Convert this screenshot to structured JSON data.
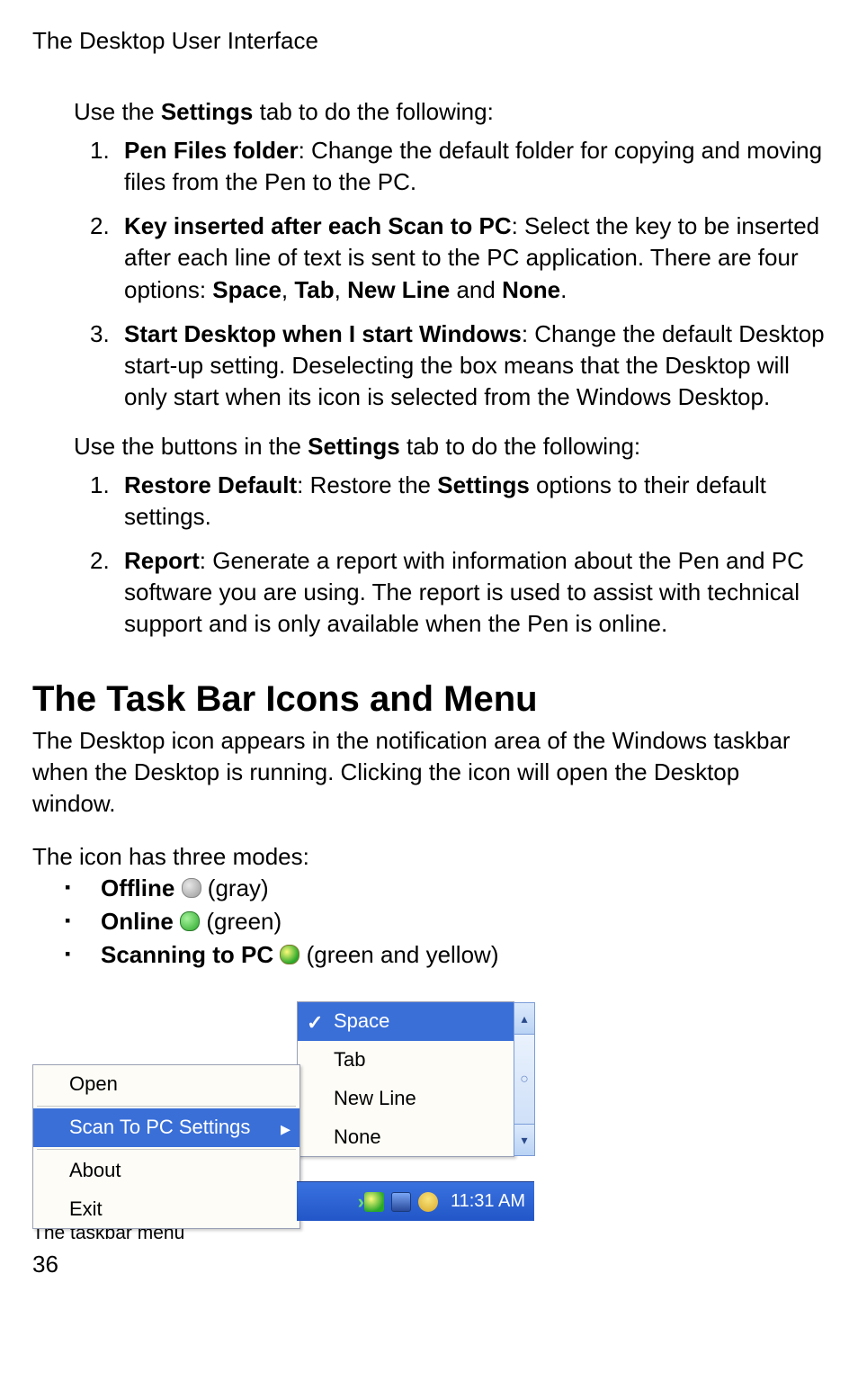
{
  "header": "The Desktop User Interface",
  "intro1_pre": "Use the ",
  "intro1_bold": "Settings",
  "intro1_post": " tab to do the following:",
  "list1": [
    {
      "num": "1.",
      "lead_bold": "Pen Files folder",
      "rest": ": Change the default folder for copying and moving files from the Pen to the PC."
    },
    {
      "num": "2.",
      "lead_bold": "Key inserted after each Scan to PC",
      "rest_pre": ": Select the key to be inserted after each line of text is sent to the PC application. There are four options: ",
      "opt1": "Space",
      "sep1": ", ",
      "opt2": "Tab",
      "sep2": ", ",
      "opt3": "New Line",
      "sep3": " and ",
      "opt4": "None",
      "end": "."
    },
    {
      "num": "3.",
      "lead_bold": "Start Desktop when I start Windows",
      "rest": ": Change the default Desktop start-up setting. Deselecting the box means that the Desktop will only start when its icon is selected from the Windows Desktop."
    }
  ],
  "intro2_pre": "Use the buttons in the ",
  "intro2_bold": "Settings",
  "intro2_post": " tab to do the following:",
  "list2": [
    {
      "num": "1.",
      "lead_bold": "Restore Default",
      "mid": ": Restore the ",
      "bold2": "Settings",
      "rest": " options to their default settings."
    },
    {
      "num": "2.",
      "lead_bold": "Report",
      "rest": ": Generate a report with information about the Pen and PC software you are using. The report is used to assist with technical support and is only available when the Pen is online."
    }
  ],
  "section_heading": "The Task Bar Icons and Menu",
  "section_para": "The Desktop icon appears in the notification area of the Windows taskbar when the Desktop is running. Clicking the icon will open the Desktop window.",
  "modes_intro": "The icon has three modes:",
  "modes": [
    {
      "label": "Offline",
      "note": " (gray)"
    },
    {
      "label": "Online",
      "note": " (green)"
    },
    {
      "label": "Scanning to PC",
      "note": " (green and yellow)"
    }
  ],
  "menu_main": {
    "open": "Open",
    "scan_settings": "Scan To PC Settings",
    "about": "About",
    "exit": "Exit"
  },
  "menu_sub": {
    "space": "Space",
    "tab": "Tab",
    "newline": "New Line",
    "none": "None"
  },
  "taskbar_clock": "11:31 AM",
  "caption": "The taskbar menu",
  "page_num": "36"
}
